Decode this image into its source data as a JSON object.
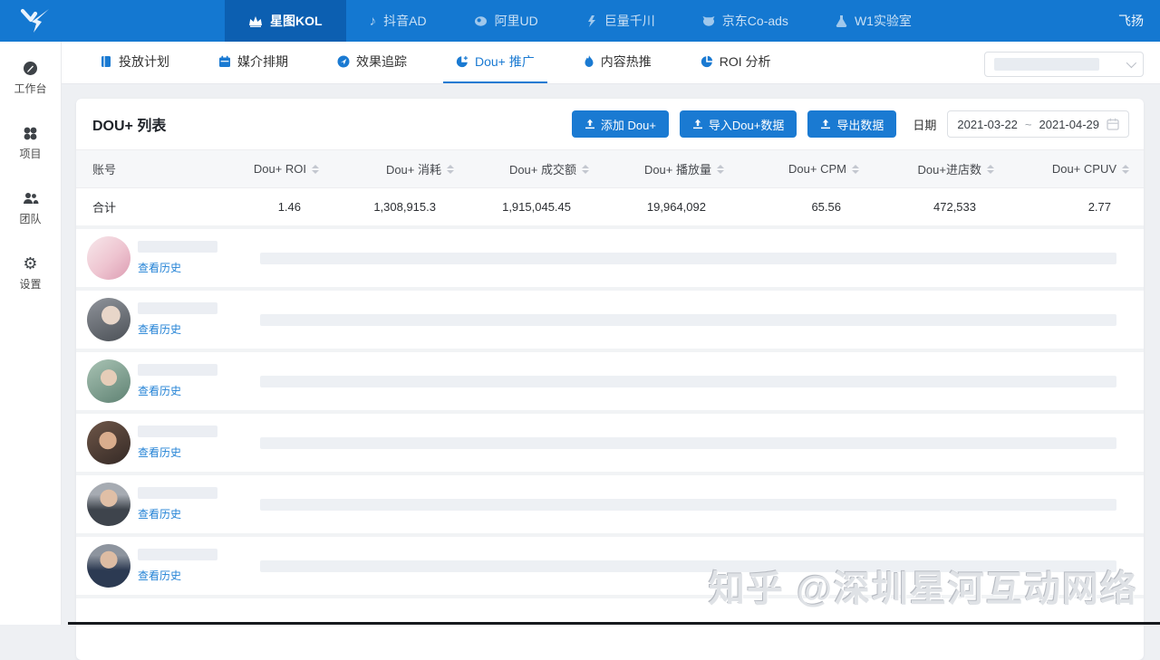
{
  "topbar": {
    "user": "飞扬",
    "tabs": [
      {
        "label": "星图KOL",
        "icon": "crown-icon",
        "active": true
      },
      {
        "label": "抖音AD",
        "icon": "music-note-icon",
        "active": false
      },
      {
        "label": "阿里UD",
        "icon": "swirl-icon",
        "active": false
      },
      {
        "label": "巨量千川",
        "icon": "qianchuan-icon",
        "active": false
      },
      {
        "label": "京东Co-ads",
        "icon": "jd-dog-icon",
        "active": false
      },
      {
        "label": "W1实验室",
        "icon": "flask-icon",
        "active": false
      }
    ]
  },
  "sidebar": {
    "items": [
      {
        "label": "工作台",
        "icon": "workbench-icon"
      },
      {
        "label": "项目",
        "icon": "projects-icon"
      },
      {
        "label": "团队",
        "icon": "team-icon"
      },
      {
        "label": "设置",
        "icon": "settings-icon"
      }
    ]
  },
  "subnav": {
    "tabs": [
      {
        "label": "投放计划",
        "icon": "plan-book-icon",
        "active": false
      },
      {
        "label": "媒介排期",
        "icon": "calendar-icon",
        "active": false
      },
      {
        "label": "效果追踪",
        "icon": "tracking-icon",
        "active": false
      },
      {
        "label": "Dou+ 推广",
        "icon": "pie-plus-icon",
        "active": true
      },
      {
        "label": "内容热推",
        "icon": "flame-icon",
        "active": false
      },
      {
        "label": "ROI 分析",
        "icon": "pie-icon",
        "active": false
      }
    ],
    "filter_select": {
      "value": "",
      "placeholder_redacted": true
    }
  },
  "panel": {
    "title": "DOU+ 列表",
    "buttons": [
      {
        "label": "添加 Dou+",
        "icon": "upload-icon"
      },
      {
        "label": "导入Dou+数据",
        "icon": "upload-icon"
      },
      {
        "label": "导出数据",
        "icon": "upload-icon"
      }
    ],
    "date_label": "日期",
    "date_range": {
      "start": "2021-03-22",
      "separator": "~",
      "end": "2021-04-29"
    }
  },
  "table": {
    "columns": [
      "账号",
      "Dou+ ROI",
      "Dou+ 消耗",
      "Dou+ 成交额",
      "Dou+ 播放量",
      "Dou+ CPM",
      "Dou+进店数",
      "Dou+ CPUV"
    ],
    "total": {
      "label": "合计",
      "values": [
        "1.46",
        "1,308,915.3",
        "1,915,045.45",
        "19,964,092",
        "65.56",
        "472,533",
        "2.77"
      ]
    },
    "rows": [
      {
        "avatar": "woman-pink-hair",
        "history_label": "查看历史"
      },
      {
        "avatar": "woman-dark-hair",
        "history_label": "查看历史"
      },
      {
        "avatar": "person-outdoor-green",
        "history_label": "查看历史"
      },
      {
        "avatar": "person-warm-dark",
        "history_label": "查看历史"
      },
      {
        "avatar": "man-gray-suit",
        "history_label": "查看历史"
      },
      {
        "avatar": "man-navy-suit",
        "history_label": "查看历史"
      }
    ]
  },
  "watermark": {
    "text": "知乎 @深圳星河互动网络"
  },
  "colors": {
    "topbar_blue": "#1478d1",
    "active_tab_blue": "#0c5fb1",
    "accent_blue": "#1a7ad2",
    "link_blue": "#2483d6",
    "page_bg": "#eef0f3",
    "placeholder_gray": "#edf0f4"
  }
}
